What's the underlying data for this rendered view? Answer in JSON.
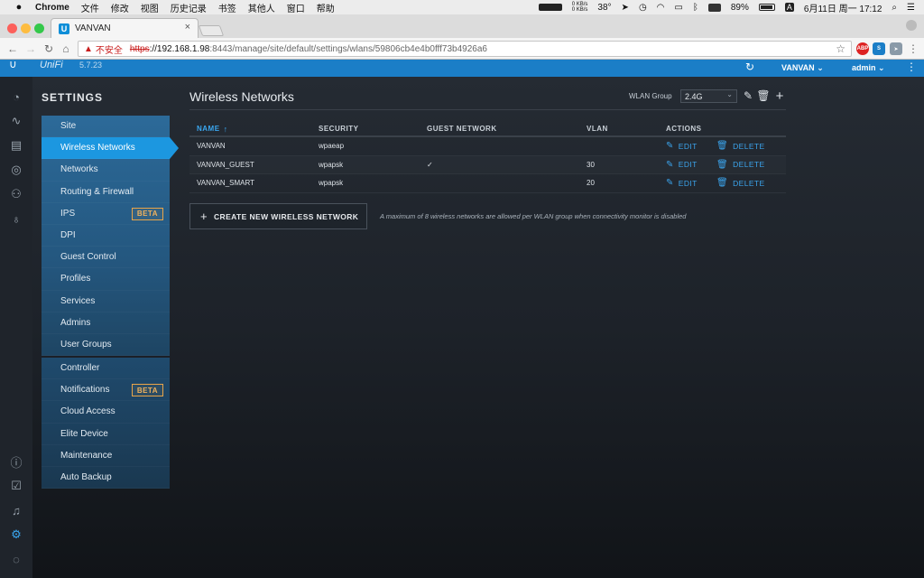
{
  "menubar": {
    "app_name": "Chrome",
    "items": [
      "文件",
      "修改",
      "视图",
      "历史记录",
      "书签",
      "其他人",
      "窗口",
      "帮助"
    ],
    "net_up": "0 KB/s",
    "net_down": "0 KB/s",
    "temperature": "38°",
    "battery": "89%",
    "input_method": "A",
    "clock": "6月11日 周一  17:12"
  },
  "browser": {
    "tab_title": "VANVAN",
    "favicon_letter": "U",
    "insecure_label": "不安全",
    "url_scheme": "https",
    "url_host": "://192.168.1.98",
    "url_rest": ":8443/manage/site/default/settings/wlans/59806cb4e4b0fff73b4926a6",
    "ext_abp": "ABP"
  },
  "unifi_header": {
    "logo": "UniFi",
    "version": "5.7.23",
    "site": "VANVAN",
    "user": "admin"
  },
  "settings": {
    "title": "SETTINGS",
    "beta_label": "BETA",
    "group1": [
      {
        "label": "Site",
        "active": false,
        "beta": false
      },
      {
        "label": "Wireless Networks",
        "active": true,
        "beta": false
      },
      {
        "label": "Networks",
        "active": false,
        "beta": false
      },
      {
        "label": "Routing & Firewall",
        "active": false,
        "beta": false
      },
      {
        "label": "IPS",
        "active": false,
        "beta": true
      },
      {
        "label": "DPI",
        "active": false,
        "beta": false
      },
      {
        "label": "Guest Control",
        "active": false,
        "beta": false
      },
      {
        "label": "Profiles",
        "active": false,
        "beta": false
      },
      {
        "label": "Services",
        "active": false,
        "beta": false
      },
      {
        "label": "Admins",
        "active": false,
        "beta": false
      },
      {
        "label": "User Groups",
        "active": false,
        "beta": false
      }
    ],
    "group2": [
      {
        "label": "Controller",
        "beta": false
      },
      {
        "label": "Notifications",
        "beta": true
      },
      {
        "label": "Cloud Access",
        "beta": false
      },
      {
        "label": "Elite Device",
        "beta": false
      },
      {
        "label": "Maintenance",
        "beta": false
      },
      {
        "label": "Auto Backup",
        "beta": false
      }
    ]
  },
  "content": {
    "title": "Wireless Networks",
    "wlan_group_label": "WLAN Group",
    "wlan_group_value": "2.4G",
    "columns": {
      "name": "NAME",
      "security": "SECURITY",
      "guest": "GUEST NETWORK",
      "vlan": "VLAN",
      "actions": "ACTIONS"
    },
    "edit_label": "EDIT",
    "delete_label": "DELETE",
    "rows": [
      {
        "name": "VANVAN",
        "security": "wpaeap",
        "guest": "",
        "vlan": ""
      },
      {
        "name": "VANVAN_GUEST",
        "security": "wpapsk",
        "guest": "✓",
        "vlan": "30"
      },
      {
        "name": "VANVAN_SMART",
        "security": "wpapsk",
        "guest": "",
        "vlan": "20"
      }
    ],
    "create_button": "CREATE NEW WIRELESS NETWORK",
    "create_note": "A maximum of 8 wireless networks are allowed per WLAN group when connectivity monitor is disabled"
  },
  "colors": {
    "accent": "#1c97e0",
    "link": "#3ba4ec",
    "beta": "#e8a54a",
    "header": "#1b7ec7"
  }
}
